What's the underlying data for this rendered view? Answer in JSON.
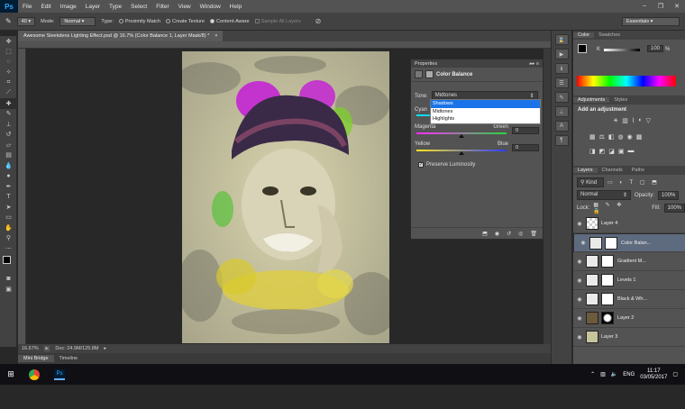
{
  "app": {
    "logo": "Ps",
    "menu": [
      "File",
      "Edit",
      "Image",
      "Layer",
      "Type",
      "Select",
      "Filter",
      "View",
      "Window",
      "Help"
    ],
    "window_controls": [
      "–",
      "❐",
      "✕"
    ]
  },
  "options": {
    "brush_size": "40",
    "mode_label": "Mode:",
    "mode_value": "Normal",
    "type_label": "Type:",
    "proximity": "Proximity Match",
    "create_texture": "Create Texture",
    "content_aware": "Content-Aware",
    "sample_all": "Sample All Layers",
    "workspace": "Essentials"
  },
  "document": {
    "tab_title": "Awesome Sleekdens Lighting Effect.psd @ 16.7% (Color Balance 1, Layer Mask/8) *",
    "tab_close": "×",
    "zoom": "16.67%",
    "doc_size": "Doc: 24.9M/125.8M"
  },
  "bottom_tabs": [
    "Mini Bridge",
    "Timeline"
  ],
  "properties": {
    "panel_title": "Properties",
    "adjustment_name": "Color Balance",
    "tone_label": "Tone:",
    "tone_value": "Midtones",
    "tone_options": [
      "Shadows",
      "Midtones",
      "Highlights"
    ],
    "highlighted_option": "Shadows",
    "sliders": [
      {
        "left": "Cyan",
        "right": "Red",
        "value": "0"
      },
      {
        "left": "Magenta",
        "right": "Green",
        "value": "0"
      },
      {
        "left": "Yellow",
        "right": "Blue",
        "value": "0"
      }
    ],
    "preserve_luminosity": "Preserve Luminosity",
    "preserve_checked": true
  },
  "color_panel": {
    "tabs": [
      "Color",
      "Swatches"
    ],
    "k_label": "K",
    "k_value": "100",
    "percent": "%"
  },
  "adjustments_panel": {
    "tabs": [
      "Adjustments",
      "Styles"
    ],
    "heading": "Add an adjustment"
  },
  "layers_panel": {
    "tabs": [
      "Layers",
      "Channels",
      "Paths"
    ],
    "kind": "Kind",
    "blend_mode": "Normal",
    "opacity_label": "Opacity:",
    "opacity_value": "100%",
    "lock_label": "Lock:",
    "fill_label": "Fill:",
    "fill_value": "100%",
    "layers": [
      {
        "name": "Layer 4",
        "type": "checker"
      },
      {
        "name": "Color Balan...",
        "type": "adj",
        "selected": true
      },
      {
        "name": "Gradient M...",
        "type": "adj"
      },
      {
        "name": "Levels 1",
        "type": "adj"
      },
      {
        "name": "Black & Wh...",
        "type": "adj"
      },
      {
        "name": "Layer 2",
        "type": "photo"
      },
      {
        "name": "Layer 3",
        "type": "texture"
      }
    ]
  },
  "taskbar": {
    "language": "ENG",
    "time": "11:17",
    "date": "03/05/2017"
  }
}
